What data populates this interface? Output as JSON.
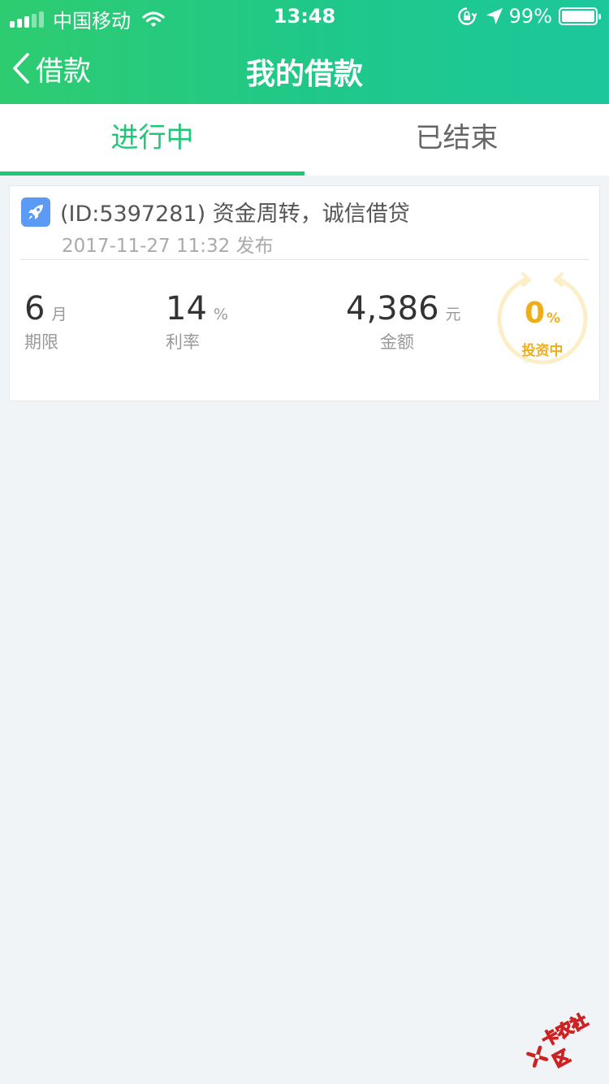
{
  "status_bar": {
    "carrier": "中国移动",
    "time": "13:48",
    "battery": "99%"
  },
  "nav": {
    "back_label": "借款",
    "title": "我的借款"
  },
  "tabs": [
    {
      "label": "进行中",
      "active": true
    },
    {
      "label": "已结束",
      "active": false
    }
  ],
  "loan": {
    "title": "(ID:5397281) 资金周转，诚信借贷",
    "date": "2017-11-27 11:32 发布",
    "term": {
      "value": "6",
      "unit": "月",
      "label": "期限"
    },
    "rate": {
      "value": "14",
      "unit": "%",
      "label": "利率"
    },
    "amount": {
      "value": "4,386",
      "unit": "元",
      "label": "金额"
    },
    "progress": {
      "value": "0",
      "unit": "%",
      "label": "投资中",
      "fraction": 0
    }
  },
  "watermark": {
    "text": "卡农社区"
  },
  "colors": {
    "header_start": "#2ecc71",
    "header_end": "#1cc79b",
    "accent_green": "#1fc877",
    "progress_gold": "#f0ad1a",
    "rocket_blue": "#5c9bf5",
    "background": "#f0f4f7"
  }
}
